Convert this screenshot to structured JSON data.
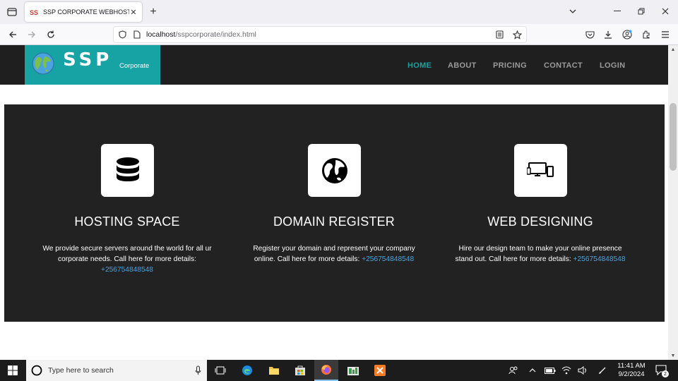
{
  "browser": {
    "tab_title": "SSP CORPORATE WEBHOSTING",
    "url_host": "localhost",
    "url_path": "/sspcorporate/index.html"
  },
  "site": {
    "logo_text": "SSP",
    "logo_sub": "Corporate",
    "menu": [
      {
        "label": "HOME",
        "active": true
      },
      {
        "label": "ABOUT",
        "active": false
      },
      {
        "label": "PRICING",
        "active": false
      },
      {
        "label": "CONTACT",
        "active": false
      },
      {
        "label": "LOGIN",
        "active": false
      }
    ],
    "accent_color": "#17a2a4",
    "features": [
      {
        "icon": "database-icon",
        "title": "HOSTING SPACE",
        "description": "We provide secure servers around the world for all ur corporate needs. Call here for more details:",
        "phone": "+256754848548"
      },
      {
        "icon": "globe-icon",
        "title": "DOMAIN REGISTER",
        "description": "Register your domain and represent your company online. Call here for more details:",
        "phone": "+256754848548"
      },
      {
        "icon": "devices-icon",
        "title": "WEB DESIGNING",
        "description": "Hire our design team to make your online presence stand out. Call here for more details:",
        "phone": "+256754848548"
      }
    ]
  },
  "taskbar": {
    "search_placeholder": "Type here to search",
    "time": "11:41 AM",
    "date": "9/2/2024",
    "notification_count": "2"
  }
}
